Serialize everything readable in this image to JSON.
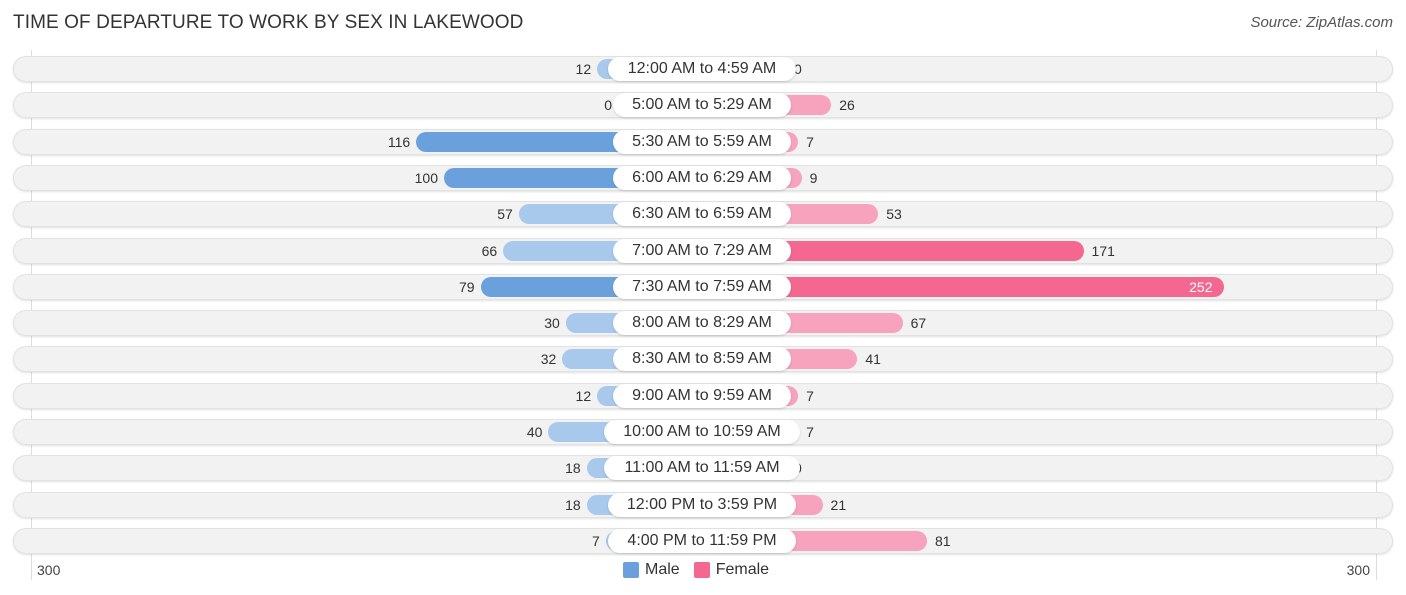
{
  "chart_data": {
    "type": "bar",
    "orientation": "horizontal-diverging",
    "title": "TIME OF DEPARTURE TO WORK BY SEX IN LAKEWOOD",
    "source": "Source: ZipAtlas.com",
    "categories": [
      "12:00 AM to 4:59 AM",
      "5:00 AM to 5:29 AM",
      "5:30 AM to 5:59 AM",
      "6:00 AM to 6:29 AM",
      "6:30 AM to 6:59 AM",
      "7:00 AM to 7:29 AM",
      "7:30 AM to 7:59 AM",
      "8:00 AM to 8:29 AM",
      "8:30 AM to 8:59 AM",
      "9:00 AM to 9:59 AM",
      "10:00 AM to 10:59 AM",
      "11:00 AM to 11:59 AM",
      "12:00 PM to 3:59 PM",
      "4:00 PM to 11:59 PM"
    ],
    "series": [
      {
        "name": "Male",
        "color": "#6aa1dc",
        "light_color": "#a8c8ec",
        "values": [
          12,
          0,
          116,
          100,
          57,
          66,
          79,
          30,
          32,
          12,
          40,
          18,
          18,
          7
        ]
      },
      {
        "name": "Female",
        "color": "#f46791",
        "light_color": "#f7a3bd",
        "values": [
          0,
          26,
          7,
          9,
          53,
          171,
          252,
          67,
          41,
          7,
          7,
          0,
          21,
          81
        ]
      }
    ],
    "axis": {
      "left_label": "300",
      "right_label": "300",
      "range": [
        0,
        300
      ]
    },
    "legend": {
      "position": "bottom-center",
      "items": [
        "Male",
        "Female"
      ]
    }
  }
}
